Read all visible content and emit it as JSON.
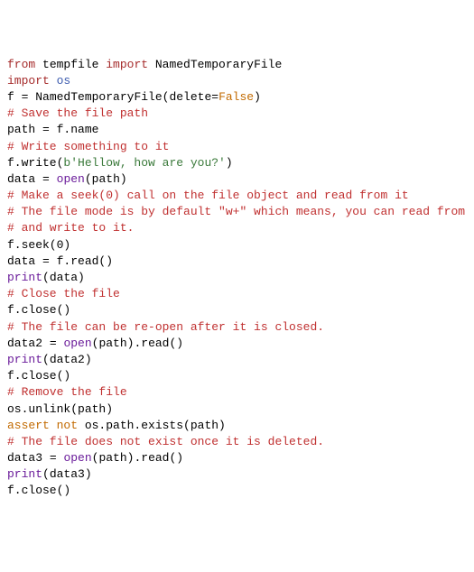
{
  "lines": [
    {
      "segments": [
        {
          "cls": "kw",
          "t": "from"
        },
        {
          "cls": "name",
          "t": " tempfile "
        },
        {
          "cls": "kw",
          "t": "import"
        },
        {
          "cls": "name",
          "t": " NamedTemporaryFile"
        }
      ]
    },
    {
      "segments": [
        {
          "cls": "kw",
          "t": "import"
        },
        {
          "cls": "name",
          "t": " "
        },
        {
          "cls": "mod",
          "t": "os"
        }
      ]
    },
    {
      "segments": [
        {
          "cls": "name",
          "t": ""
        }
      ]
    },
    {
      "segments": [
        {
          "cls": "name",
          "t": "f "
        },
        {
          "cls": "op",
          "t": "="
        },
        {
          "cls": "name",
          "t": " NamedTemporaryFile(delete"
        },
        {
          "cls": "op",
          "t": "="
        },
        {
          "cls": "bool",
          "t": "False"
        },
        {
          "cls": "name",
          "t": ")"
        }
      ]
    },
    {
      "segments": [
        {
          "cls": "name",
          "t": ""
        }
      ]
    },
    {
      "segments": [
        {
          "cls": "com",
          "t": "# Save the file path"
        }
      ]
    },
    {
      "segments": [
        {
          "cls": "name",
          "t": "path "
        },
        {
          "cls": "op",
          "t": "="
        },
        {
          "cls": "name",
          "t": " f.name"
        }
      ]
    },
    {
      "segments": [
        {
          "cls": "name",
          "t": ""
        }
      ]
    },
    {
      "segments": [
        {
          "cls": "com",
          "t": "# Write something to it"
        }
      ]
    },
    {
      "segments": [
        {
          "cls": "name",
          "t": "f.write("
        },
        {
          "cls": "str",
          "t": "b'Hellow, how are you?'"
        },
        {
          "cls": "name",
          "t": ")"
        }
      ]
    },
    {
      "segments": [
        {
          "cls": "name",
          "t": ""
        }
      ]
    },
    {
      "segments": [
        {
          "cls": "name",
          "t": "data "
        },
        {
          "cls": "op",
          "t": "="
        },
        {
          "cls": "name",
          "t": " "
        },
        {
          "cls": "func",
          "t": "open"
        },
        {
          "cls": "name",
          "t": "(path)"
        }
      ]
    },
    {
      "segments": [
        {
          "cls": "name",
          "t": ""
        }
      ]
    },
    {
      "segments": [
        {
          "cls": "com",
          "t": "# Make a seek(0) call on the file object and read from it"
        }
      ]
    },
    {
      "segments": [
        {
          "cls": "com",
          "t": "# The file mode is by default \"w+\" which means, you can read from"
        }
      ]
    },
    {
      "segments": [
        {
          "cls": "com",
          "t": "# and write to it."
        }
      ]
    },
    {
      "segments": [
        {
          "cls": "name",
          "t": "f.seek("
        },
        {
          "cls": "name",
          "t": "0"
        },
        {
          "cls": "name",
          "t": ")"
        }
      ]
    },
    {
      "segments": [
        {
          "cls": "name",
          "t": "data "
        },
        {
          "cls": "op",
          "t": "="
        },
        {
          "cls": "name",
          "t": " f.read()"
        }
      ]
    },
    {
      "segments": [
        {
          "cls": "func",
          "t": "print"
        },
        {
          "cls": "name",
          "t": "(data)"
        }
      ]
    },
    {
      "segments": [
        {
          "cls": "name",
          "t": ""
        }
      ]
    },
    {
      "segments": [
        {
          "cls": "com",
          "t": "# Close the file"
        }
      ]
    },
    {
      "segments": [
        {
          "cls": "name",
          "t": "f.close()"
        }
      ]
    },
    {
      "segments": [
        {
          "cls": "name",
          "t": ""
        }
      ]
    },
    {
      "segments": [
        {
          "cls": "com",
          "t": "# The file can be re-open after it is closed."
        }
      ]
    },
    {
      "segments": [
        {
          "cls": "name",
          "t": "data2 "
        },
        {
          "cls": "op",
          "t": "="
        },
        {
          "cls": "name",
          "t": " "
        },
        {
          "cls": "func",
          "t": "open"
        },
        {
          "cls": "name",
          "t": "(path).read()"
        }
      ]
    },
    {
      "segments": [
        {
          "cls": "func",
          "t": "print"
        },
        {
          "cls": "name",
          "t": "(data2)"
        }
      ]
    },
    {
      "segments": [
        {
          "cls": "name",
          "t": "f.close()"
        }
      ]
    },
    {
      "segments": [
        {
          "cls": "name",
          "t": ""
        }
      ]
    },
    {
      "segments": [
        {
          "cls": "com",
          "t": "# Remove the file"
        }
      ]
    },
    {
      "segments": [
        {
          "cls": "name",
          "t": "os.unlink(path)"
        }
      ]
    },
    {
      "segments": [
        {
          "cls": "assert",
          "t": "assert not"
        },
        {
          "cls": "name",
          "t": " os.path.exists(path)"
        }
      ]
    },
    {
      "segments": [
        {
          "cls": "name",
          "t": ""
        }
      ]
    },
    {
      "segments": [
        {
          "cls": "com",
          "t": "# The file does not exist once it is deleted."
        }
      ]
    },
    {
      "segments": [
        {
          "cls": "name",
          "t": "data3 "
        },
        {
          "cls": "op",
          "t": "="
        },
        {
          "cls": "name",
          "t": " "
        },
        {
          "cls": "func",
          "t": "open"
        },
        {
          "cls": "name",
          "t": "(path).read()"
        }
      ]
    },
    {
      "segments": [
        {
          "cls": "func",
          "t": "print"
        },
        {
          "cls": "name",
          "t": "(data3)"
        }
      ]
    },
    {
      "segments": [
        {
          "cls": "name",
          "t": "f.close()"
        }
      ]
    }
  ]
}
